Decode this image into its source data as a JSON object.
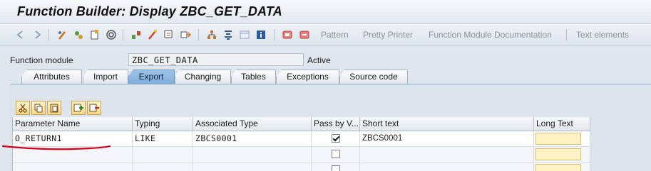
{
  "window": {
    "title": "Function Builder: Display ZBC_GET_DATA"
  },
  "toolbar": {
    "icons": [
      "back-arrow-icon",
      "forward-arrow-icon",
      "edit-toggle-icon",
      "other-object-icon",
      "active-inactive-icon",
      "check-icon",
      "activate-icon",
      "test-icon",
      "where-used-icon",
      "display-object-list-icon",
      "navigation-window-icon",
      "hierarchy-icon",
      "enhancement-icon",
      "info-icon",
      "pattern-icon",
      "pretty-printer-icon"
    ],
    "buttons": {
      "pattern": "Pattern",
      "pretty_printer": "Pretty Printer",
      "documentation": "Function Module Documentation",
      "text_elements": "Text elements"
    }
  },
  "function_module": {
    "label": "Function module",
    "value": "ZBC_GET_DATA",
    "status": "Active"
  },
  "tabs": [
    {
      "label": "Attributes",
      "active": false
    },
    {
      "label": "Import",
      "active": false
    },
    {
      "label": "Export",
      "active": true
    },
    {
      "label": "Changing",
      "active": false
    },
    {
      "label": "Tables",
      "active": false
    },
    {
      "label": "Exceptions",
      "active": false
    },
    {
      "label": "Source code",
      "active": false
    }
  ],
  "grid": {
    "columns": [
      "Parameter Name",
      "Typing",
      "Associated Type",
      "Pass by V...",
      "Short text",
      "Long Text"
    ],
    "rows": [
      {
        "name": "O_RETURN1",
        "typing": "LIKE",
        "assoc_type": "ZBCS0001",
        "pass_by_value": true,
        "short_text": "ZBCS0001"
      },
      {
        "name": "",
        "typing": "",
        "assoc_type": "",
        "pass_by_value": false,
        "short_text": ""
      },
      {
        "name": "",
        "typing": "",
        "assoc_type": "",
        "pass_by_value": false,
        "short_text": ""
      }
    ],
    "toolbar_icons": [
      "cut-icon",
      "copy-icon",
      "paste-icon",
      "insert-row-icon",
      "delete-row-icon"
    ]
  },
  "colors": {
    "accent_tab": "#7fb0dd",
    "annotation_underline": "#d6001c",
    "long_text_button": "#fff3c4"
  }
}
